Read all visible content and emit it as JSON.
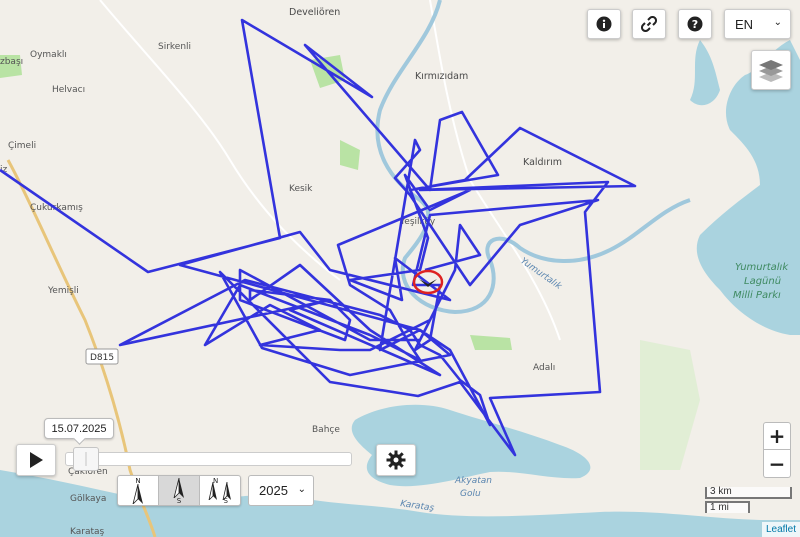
{
  "map": {
    "places": {
      "develioren": "Develiören",
      "sirkenli": "Sirkenli",
      "oymakli": "Oymaklı",
      "izbasi": "zbaşı",
      "helvaci": "Helvacı",
      "cimeli": "Çimeli",
      "kirmizidam": "Kırmızıdam",
      "kaldirim": "Kaldırım",
      "kesik": "Kesik",
      "cukurkamis": "Çukurkamış",
      "iz": "iz",
      "yesilkoy": "Yeşilköy",
      "yemisli": "Yemişli",
      "adali": "Adalı",
      "bahce": "Bahçe",
      "cakiroren": "Çakıören",
      "golkaya": "Gölkaya",
      "karatas_town": "Karataş",
      "karatas_coast": "Karataş",
      "yumurtalik_river": "Yumurtalık",
      "lagoon": [
        "Yumurtalık",
        "Lagünü",
        "Milli Parkı"
      ],
      "akyatan": [
        "Akyatan",
        "Golu"
      ],
      "road": "D815"
    },
    "track_color": "#3333dd",
    "marker_color": "#dd2222"
  },
  "controls": {
    "info_icon": "info-icon",
    "link_icon": "link-icon",
    "help_icon": "help-icon",
    "language": "EN",
    "layers_icon": "layers-icon",
    "zoom_in": "+",
    "zoom_out": "−",
    "scale_km": "3 km",
    "scale_mi": "1 mi",
    "attribution": "Leaflet"
  },
  "timeline": {
    "date": "15.07.2025",
    "position": 0.03,
    "year": "2025",
    "north_modes": [
      {
        "top": "N",
        "bottom": ""
      },
      {
        "top": "",
        "bottom": "S"
      },
      {
        "top": "N",
        "bottom": "S"
      }
    ]
  }
}
